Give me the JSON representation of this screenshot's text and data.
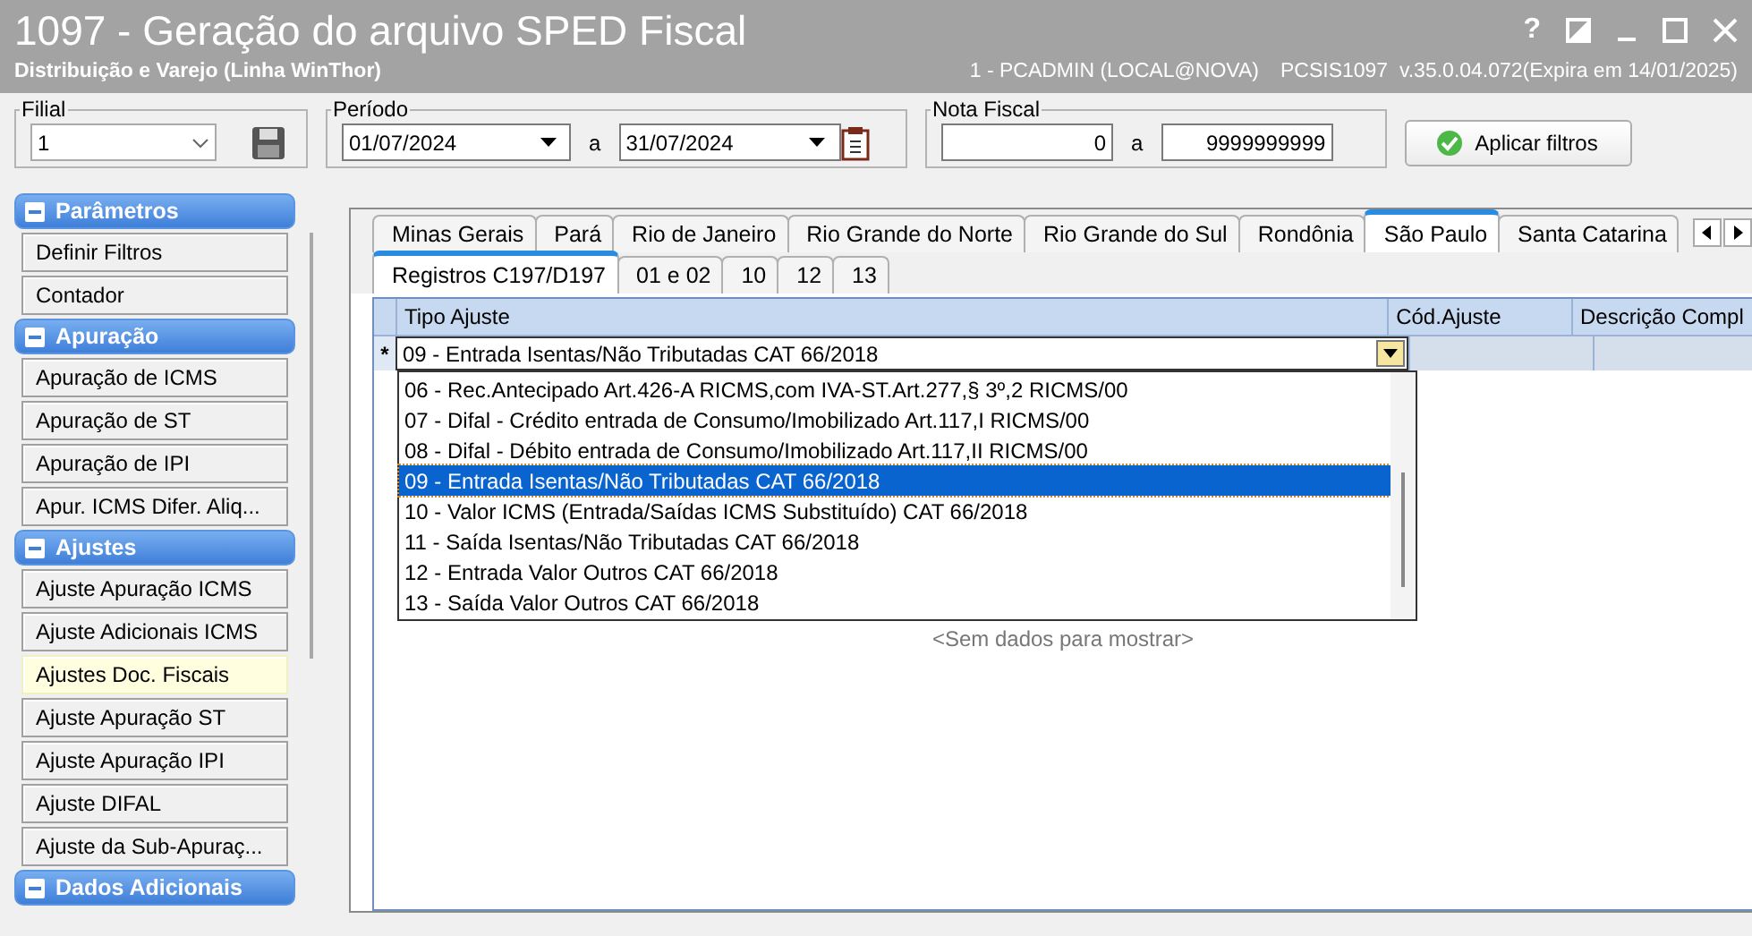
{
  "window": {
    "title": "1097 - Geração do arquivo SPED Fiscal",
    "subtitle": "Distribuição e Varejo (Linha WinThor)",
    "session_info": "1 - PCADMIN (LOCAL@NOVA)",
    "version_info": "PCSIS1097  v.35.0.04.072(Expira em 14/01/2025)",
    "help_label": "?"
  },
  "filters": {
    "filial": {
      "label": "Filial",
      "value": "1"
    },
    "periodo": {
      "label": "Período",
      "from": "01/07/2024",
      "separator": "a",
      "to": "31/07/2024"
    },
    "nota_fiscal": {
      "label": "Nota Fiscal",
      "from": "0",
      "separator": "a",
      "to": "9999999999"
    },
    "apply_button": "Aplicar filtros"
  },
  "sidebar": {
    "sections": [
      {
        "title": "Parâmetros",
        "expanded": true,
        "items": [
          {
            "label": "Definir Filtros",
            "selected": false
          },
          {
            "label": "Contador",
            "selected": false
          }
        ]
      },
      {
        "title": "Apuração",
        "expanded": true,
        "items": [
          {
            "label": "Apuração de ICMS",
            "selected": false
          },
          {
            "label": "Apuração de ST",
            "selected": false
          },
          {
            "label": "Apuração de IPI",
            "selected": false
          },
          {
            "label": "Apur. ICMS Difer. Aliq...",
            "selected": false
          }
        ]
      },
      {
        "title": "Ajustes",
        "expanded": true,
        "items": [
          {
            "label": "Ajuste Apuração ICMS",
            "selected": false
          },
          {
            "label": "Ajuste Adicionais ICMS",
            "selected": false
          },
          {
            "label": "Ajustes Doc. Fiscais",
            "selected": true
          },
          {
            "label": "Ajuste Apuração ST",
            "selected": false
          },
          {
            "label": "Ajuste Apuração IPI",
            "selected": false
          },
          {
            "label": "Ajuste DIFAL",
            "selected": false
          },
          {
            "label": "Ajuste da Sub-Apuraç...",
            "selected": false
          }
        ]
      },
      {
        "title": "Dados Adicionais",
        "expanded": true
      }
    ]
  },
  "state_tabs": [
    {
      "label": "Minas Gerais",
      "selected": false
    },
    {
      "label": "Pará",
      "selected": false
    },
    {
      "label": "Rio de Janeiro",
      "selected": false
    },
    {
      "label": "Rio Grande do Norte",
      "selected": false
    },
    {
      "label": "Rio Grande do Sul",
      "selected": false
    },
    {
      "label": "Rondônia",
      "selected": false
    },
    {
      "label": "São Paulo",
      "selected": true
    },
    {
      "label": "Santa Catarina",
      "selected": false
    }
  ],
  "sub_tabs": [
    {
      "label": "Registros C197/D197",
      "selected": true
    },
    {
      "label": "01 e 02",
      "selected": false
    },
    {
      "label": "10",
      "selected": false
    },
    {
      "label": "12",
      "selected": false
    },
    {
      "label": "13",
      "selected": false
    }
  ],
  "grid": {
    "columns": [
      "Tipo Ajuste",
      "Cód.Ajuste",
      "Descrição Compl"
    ],
    "new_row_marker": "*",
    "edit_value": "09 - Entrada Isentas/Não Tributadas CAT 66/2018",
    "dropdown_options": [
      {
        "label": "06 - Rec.Antecipado Art.426-A RICMS,com IVA-ST.Art.277,§ 3º,2 RICMS/00",
        "selected": false
      },
      {
        "label": "07 - Difal - Crédito entrada de Consumo/Imobilizado Art.117,I RICMS/00",
        "selected": false
      },
      {
        "label": "08 - Difal - Débito entrada de Consumo/Imobilizado Art.117,II RICMS/00",
        "selected": false
      },
      {
        "label": "09 - Entrada Isentas/Não Tributadas CAT 66/2018",
        "selected": true
      },
      {
        "label": "10 - Valor ICMS (Entrada/Saídas ICMS Substituído) CAT 66/2018",
        "selected": false
      },
      {
        "label": "11 - Saída Isentas/Não Tributadas CAT 66/2018",
        "selected": false
      },
      {
        "label": "12 - Entrada Valor Outros CAT 66/2018",
        "selected": false
      },
      {
        "label": "13 - Saída Valor Outros CAT 66/2018",
        "selected": false
      }
    ],
    "empty_message": "<Sem dados para mostrar>"
  }
}
